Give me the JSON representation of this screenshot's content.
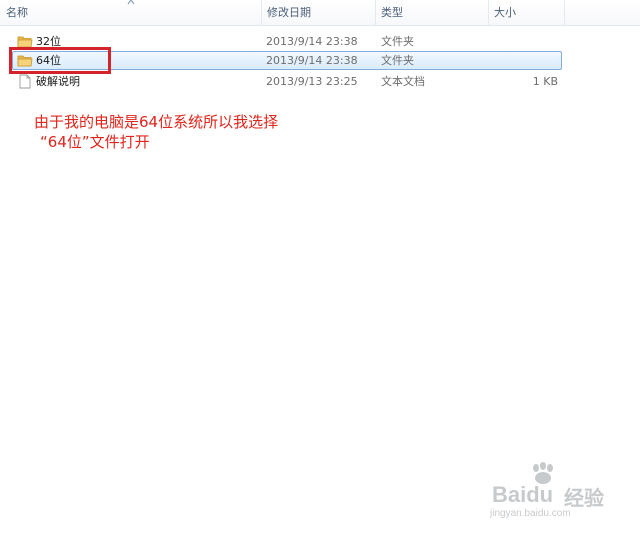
{
  "columns": {
    "name": "名称",
    "modified": "修改日期",
    "type": "类型",
    "size": "大小"
  },
  "files": [
    {
      "name": "32位",
      "modified": "2013/9/14 23:38",
      "type": "文件夹",
      "size": "",
      "icon": "folder-icon",
      "selected": false
    },
    {
      "name": "64位",
      "modified": "2013/9/14 23:38",
      "type": "文件夹",
      "size": "",
      "icon": "folder-icon",
      "selected": true
    },
    {
      "name": "破解说明",
      "modified": "2013/9/13 23:25",
      "type": "文本文档",
      "size": "1 KB",
      "icon": "text-document-icon",
      "selected": false
    }
  ],
  "annotation": {
    "line1": "由于我的电脑是64位系统所以我选择",
    "line2": "“64位”文件打开",
    "color": "#e0251b"
  },
  "watermark": {
    "brand": "Baidu",
    "cn": "经验",
    "url": "jingyan.baidu.com"
  },
  "colors": {
    "highlight_box": "#d4232a",
    "selection_border": "#84acdd",
    "folder": "#e8b74a"
  }
}
